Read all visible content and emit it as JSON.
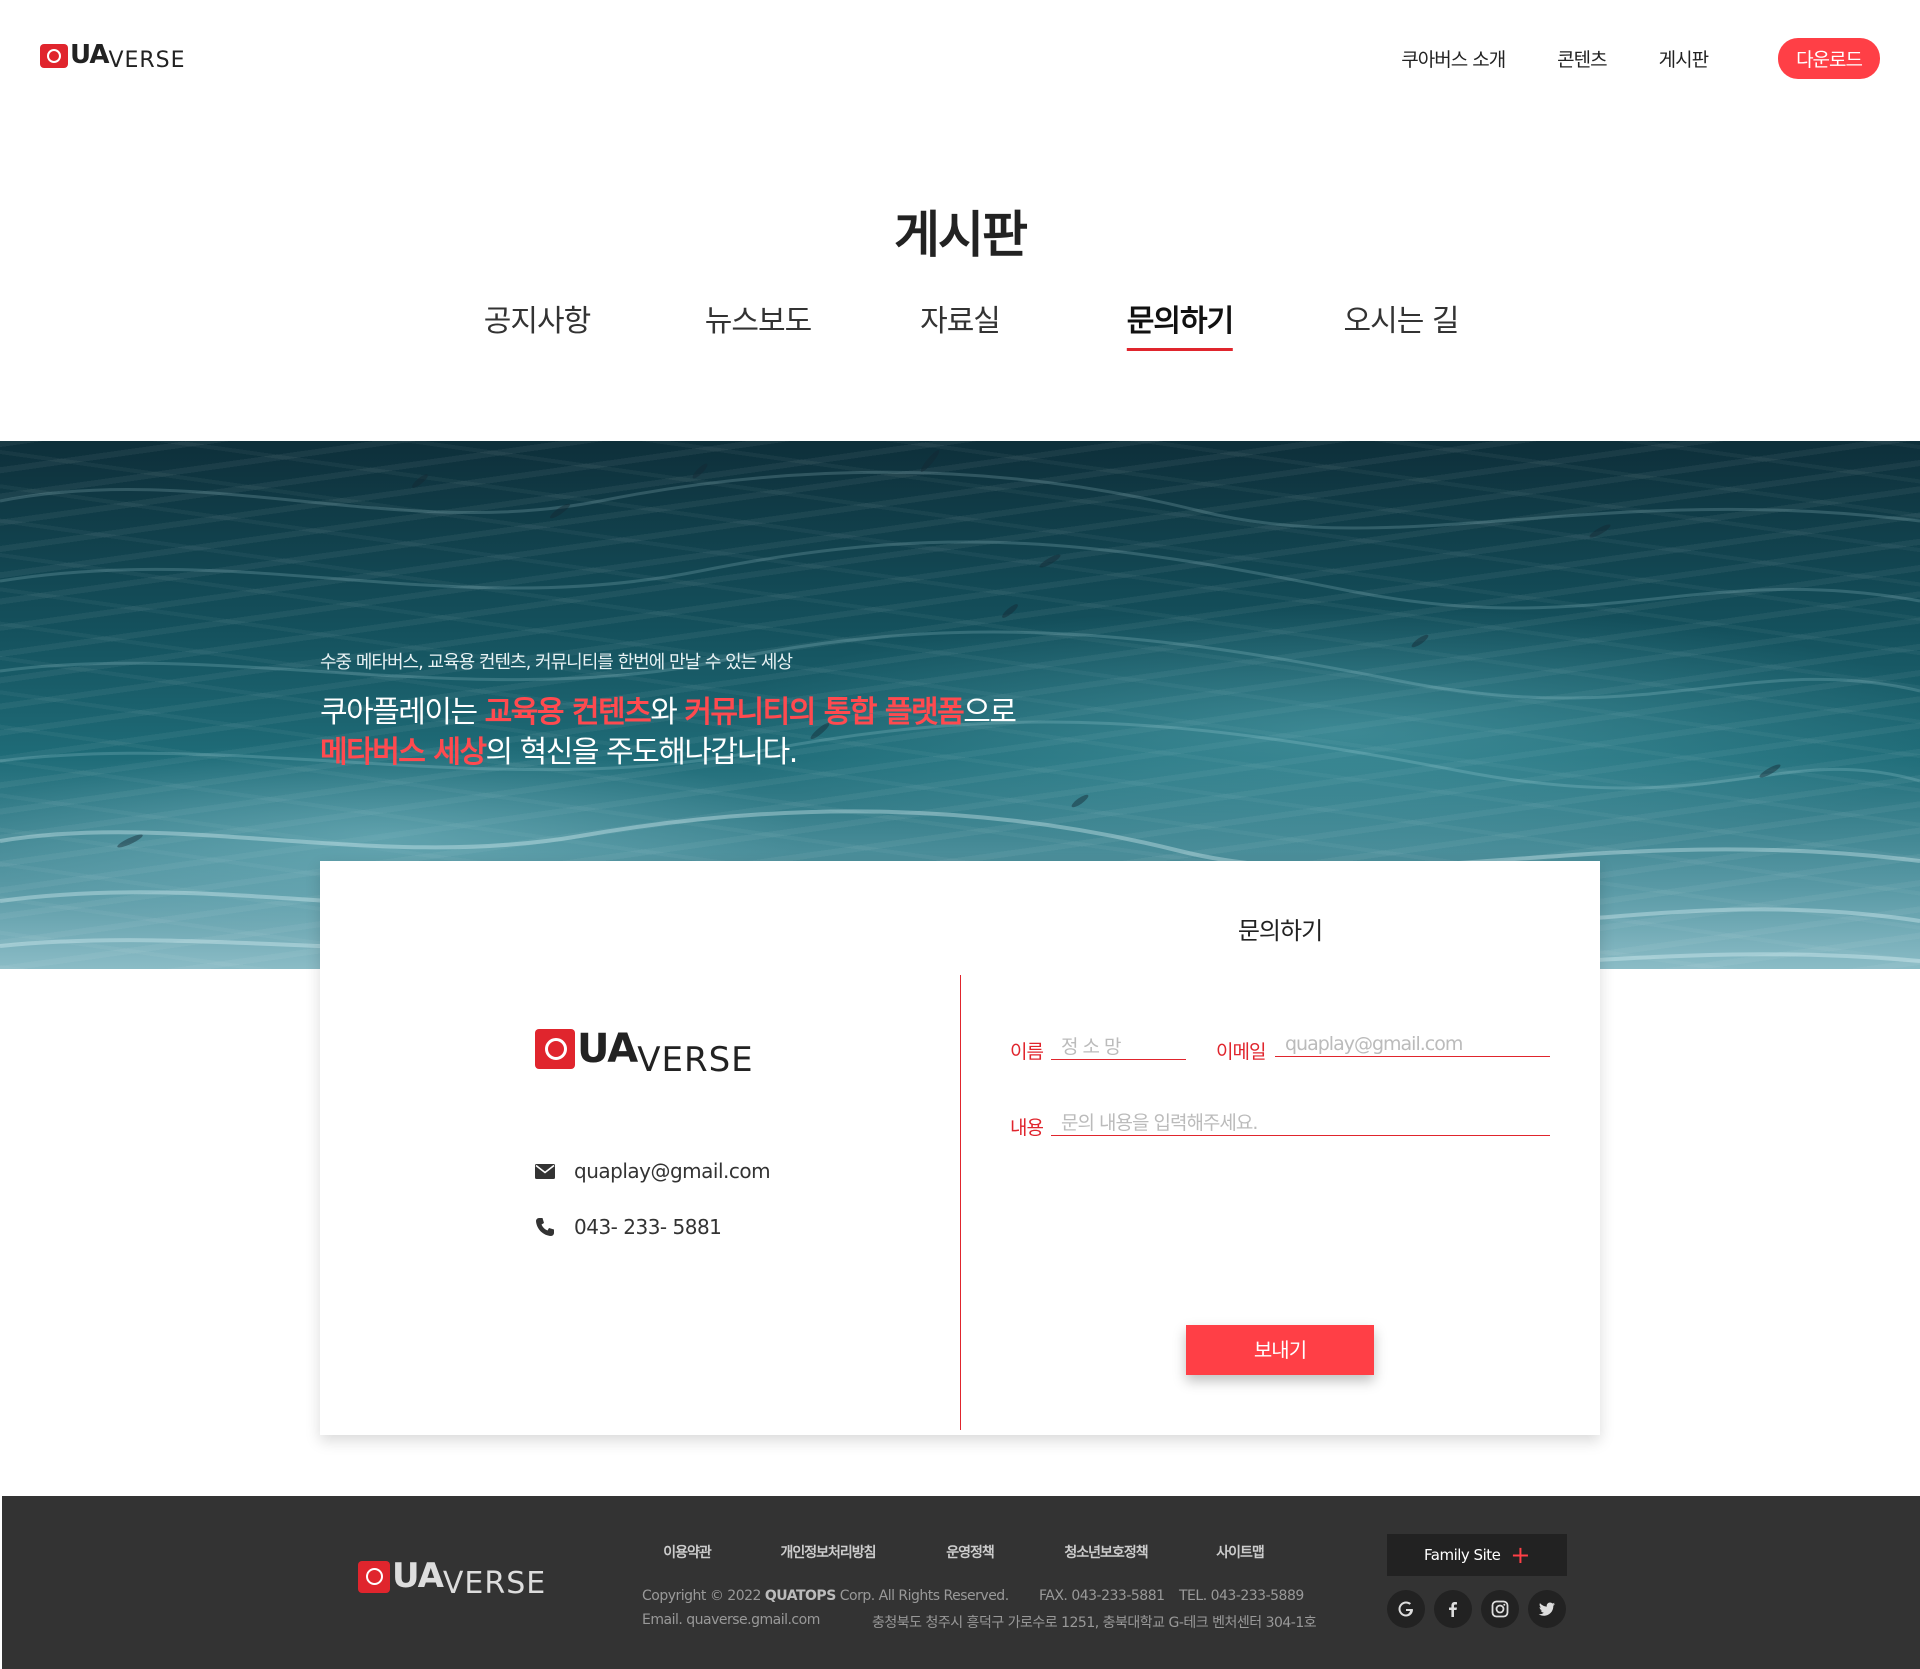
{
  "header": {
    "brand": {
      "q": "Q",
      "ua": "UA",
      "verse": "VERSE"
    },
    "nav": [
      "쿠아버스 소개",
      "콘텐츠",
      "게시판"
    ],
    "download_label": "다운로드"
  },
  "page_title": "게시판",
  "tabs": [
    {
      "label": "공지사항",
      "active": false
    },
    {
      "label": "뉴스보도",
      "active": false
    },
    {
      "label": "자료실",
      "active": false
    },
    {
      "label": "문의하기",
      "active": true
    },
    {
      "label": "오시는 길",
      "active": false
    }
  ],
  "hero": {
    "subtitle": "수중 메타버스, 교육용 컨텐츠, 커뮤니티를 한번에 만날 수 있는 세상",
    "line1": {
      "prefix": "쿠아플레이는 ",
      "highlight1": "교육용 컨텐츠",
      "middle": "와 ",
      "highlight2": "커뮤니티의 통합 플랫폼",
      "suffix": "으로"
    },
    "line2": {
      "highlight": "메타버스 세상",
      "suffix": "의 혁신을 주도해나갑니다."
    }
  },
  "contact": {
    "email": "quaplay@gmail.com",
    "phone": "043- 233- 5881",
    "icons": {
      "email": "envelope-icon",
      "phone": "phone-icon"
    }
  },
  "form": {
    "title": "문의하기",
    "name_label": "이름",
    "name_placeholder": "정 소 망",
    "email_label": "이메일",
    "email_placeholder": "quaplay@gmail.com",
    "content_label": "내용",
    "content_placeholder": "문의 내용을 입력해주세요.",
    "submit_label": "보내기"
  },
  "footer": {
    "links": [
      "이용약관",
      "개인정보처리방침",
      "운영정책",
      "청소년보호정책",
      "사이트맵"
    ],
    "copyright_prefix": "Copyright © 2022 ",
    "copyright_company": "QUATOPS",
    "copyright_suffix": " Corp. All Rights Reserved.",
    "fax": "FAX. 043-233-5881",
    "tel": "TEL. 043-233-5889",
    "email": "Email. quaverse.gmail.com",
    "address": "충청북도 청주시 흥덕구 가로수로 1251, 충북대학교 G-테크 벤처센터 304-1호",
    "family_site_label": "Family Site",
    "social": [
      "google-icon",
      "facebook-icon",
      "instagram-icon",
      "twitter-icon"
    ]
  },
  "colors": {
    "accent": "#ff3f46",
    "brand_red": "#e0252d",
    "footer_bg": "#333333",
    "hero_water": "#14505c"
  }
}
